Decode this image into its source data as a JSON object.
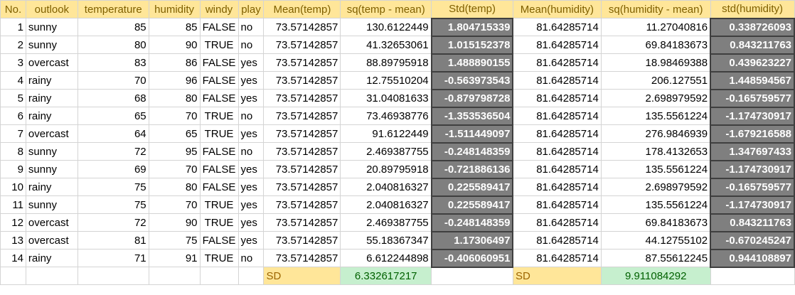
{
  "headers": [
    "No.",
    "outlook",
    "temperature",
    "humidity",
    "windy",
    "play",
    "Mean(temp)",
    "sq(temp - mean)",
    "Std(temp)",
    "Mean(humidity)",
    "sq(humidity - mean)",
    "std(humidity)"
  ],
  "rows": [
    [
      "1",
      "sunny",
      "85",
      "85",
      "FALSE",
      "no",
      "73.57142857",
      "130.6122449",
      "1.804715339",
      "81.64285714",
      "11.27040816",
      "0.338726093"
    ],
    [
      "2",
      "sunny",
      "80",
      "90",
      "TRUE",
      "no",
      "73.57142857",
      "41.32653061",
      "1.015152378",
      "81.64285714",
      "69.84183673",
      "0.843211763"
    ],
    [
      "3",
      "overcast",
      "83",
      "86",
      "FALSE",
      "yes",
      "73.57142857",
      "88.89795918",
      "1.488890155",
      "81.64285714",
      "18.98469388",
      "0.439623227"
    ],
    [
      "4",
      "rainy",
      "70",
      "96",
      "FALSE",
      "yes",
      "73.57142857",
      "12.75510204",
      "-0.563973543",
      "81.64285714",
      "206.127551",
      "1.448594567"
    ],
    [
      "5",
      "rainy",
      "68",
      "80",
      "FALSE",
      "yes",
      "73.57142857",
      "31.04081633",
      "-0.879798728",
      "81.64285714",
      "2.698979592",
      "-0.165759577"
    ],
    [
      "6",
      "rainy",
      "65",
      "70",
      "TRUE",
      "no",
      "73.57142857",
      "73.46938776",
      "-1.353536504",
      "81.64285714",
      "135.5561224",
      "-1.174730917"
    ],
    [
      "7",
      "overcast",
      "64",
      "65",
      "TRUE",
      "yes",
      "73.57142857",
      "91.6122449",
      "-1.511449097",
      "81.64285714",
      "276.9846939",
      "-1.679216588"
    ],
    [
      "8",
      "sunny",
      "72",
      "95",
      "FALSE",
      "no",
      "73.57142857",
      "2.469387755",
      "-0.248148359",
      "81.64285714",
      "178.4132653",
      "1.347697433"
    ],
    [
      "9",
      "sunny",
      "69",
      "70",
      "FALSE",
      "yes",
      "73.57142857",
      "20.89795918",
      "-0.721886136",
      "81.64285714",
      "135.5561224",
      "-1.174730917"
    ],
    [
      "10",
      "rainy",
      "75",
      "80",
      "FALSE",
      "yes",
      "73.57142857",
      "2.040816327",
      "0.225589417",
      "81.64285714",
      "2.698979592",
      "-0.165759577"
    ],
    [
      "11",
      "sunny",
      "75",
      "70",
      "TRUE",
      "yes",
      "73.57142857",
      "2.040816327",
      "0.225589417",
      "81.64285714",
      "135.5561224",
      "-1.174730917"
    ],
    [
      "12",
      "overcast",
      "72",
      "90",
      "TRUE",
      "yes",
      "73.57142857",
      "2.469387755",
      "-0.248148359",
      "81.64285714",
      "69.84183673",
      "0.843211763"
    ],
    [
      "13",
      "overcast",
      "81",
      "75",
      "FALSE",
      "yes",
      "73.57142857",
      "55.18367347",
      "1.17306497",
      "81.64285714",
      "44.12755102",
      "-0.670245247"
    ],
    [
      "14",
      "rainy",
      "71",
      "91",
      "TRUE",
      "no",
      "73.57142857",
      "6.612244898",
      "-0.406060951",
      "81.64285714",
      "87.55612245",
      "0.944108897"
    ]
  ],
  "summary": {
    "temp_label": "SD",
    "temp_value": "6.332617217",
    "humidity_label": "SD",
    "humidity_value": "9.911084292"
  },
  "colors": {
    "header_fill": "#ffe699",
    "header_text": "#7f6000",
    "std_fill": "#7f7f7f",
    "sd_value_fill": "#c6efce",
    "sd_value_text": "#006100"
  }
}
